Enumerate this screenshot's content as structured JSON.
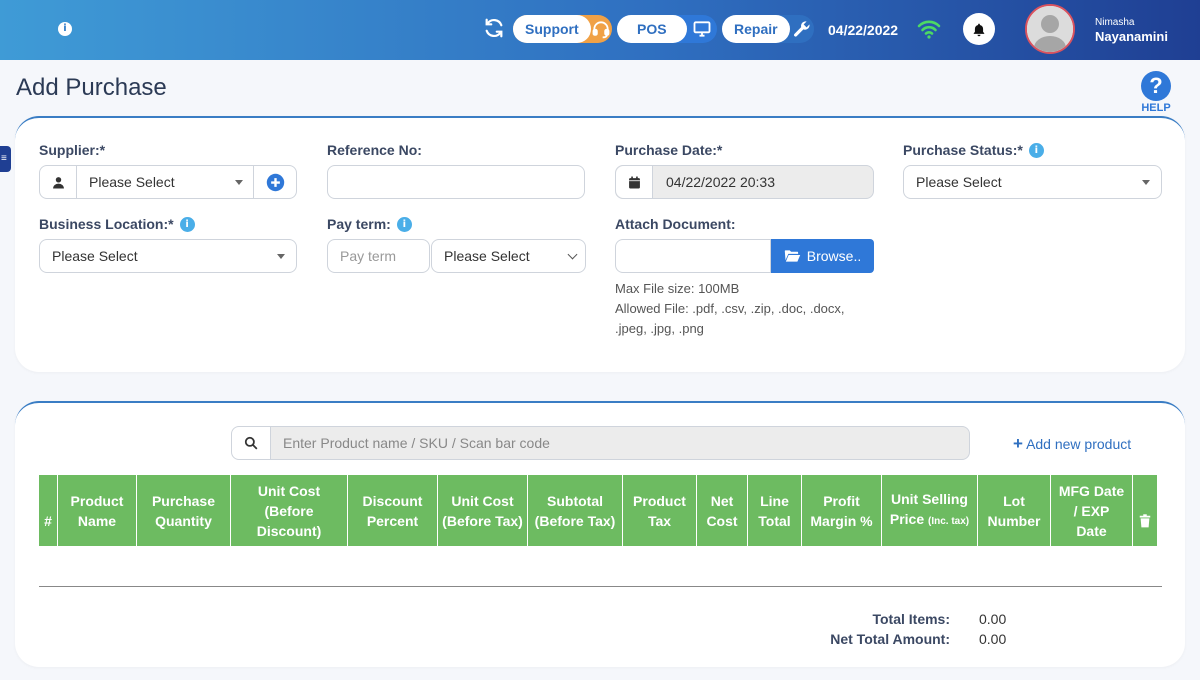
{
  "topbar": {
    "support_label": "Support",
    "pos_label": "POS",
    "repair_label": "Repair",
    "date": "04/22/2022",
    "user_first": "Nimasha",
    "user_last": "Nayanamini",
    "icons": [
      "info-icon",
      "refresh-icon",
      "headset-icon",
      "monitor-icon",
      "wrench-icon",
      "wifi-icon",
      "bell-icon",
      "avatar"
    ]
  },
  "page": {
    "title": "Add Purchase",
    "help_label": "HELP"
  },
  "form": {
    "supplier": {
      "label": "Supplier:*",
      "value": "Please Select"
    },
    "reference": {
      "label": "Reference No:",
      "value": ""
    },
    "purchase_date": {
      "label": "Purchase Date:*",
      "value": "04/22/2022 20:33"
    },
    "purchase_status": {
      "label": "Purchase Status:*",
      "value": "Please Select"
    },
    "business_location": {
      "label": "Business Location:*",
      "value": "Please Select"
    },
    "pay_term": {
      "label": "Pay term:",
      "placeholder": "Pay term",
      "unit_value": "Please Select"
    },
    "attach": {
      "label": "Attach Document:",
      "browse_label": "Browse..",
      "note_size": "Max File size: 100MB",
      "note_allowed_1": "Allowed File: .pdf, .csv, .zip, .doc, .docx,",
      "note_allowed_2": ".jpeg, .jpg, .png"
    }
  },
  "products": {
    "search_placeholder": "Enter Product name / SKU / Scan bar code",
    "add_new_label": "Add new product",
    "columns": {
      "num": "#",
      "product_name": [
        "Product",
        "Name"
      ],
      "purchase_qty": [
        "Purchase",
        "Quantity"
      ],
      "unit_cost_before_discount": [
        "Unit Cost",
        "(Before",
        "Discount)"
      ],
      "discount_percent": [
        "Discount",
        "Percent"
      ],
      "unit_cost_before_tax": [
        "Unit Cost",
        "(Before Tax)"
      ],
      "subtotal_before_tax": [
        "Subtotal",
        "(Before Tax)"
      ],
      "product_tax": [
        "Product",
        "Tax"
      ],
      "net_cost": [
        "Net",
        "Cost"
      ],
      "line_total": [
        "Line",
        "Total"
      ],
      "profit_margin": [
        "Profit",
        "Margin %"
      ],
      "unit_selling_price": [
        "Unit Selling",
        "Price",
        "(Inc. tax)"
      ],
      "lot_number": [
        "Lot",
        "Number"
      ],
      "mfg_exp_date": [
        "MFG Date",
        "/ EXP",
        "Date"
      ]
    },
    "total_items_label": "Total Items:",
    "total_items_value": "0.00",
    "net_total_label": "Net Total Amount:",
    "net_total_value": "0.00"
  },
  "colors": {
    "accent": "#2f6fc0",
    "table_header": "#6dbb61",
    "support_pill": "#f0a146",
    "avatar_border": "#d9535f"
  }
}
